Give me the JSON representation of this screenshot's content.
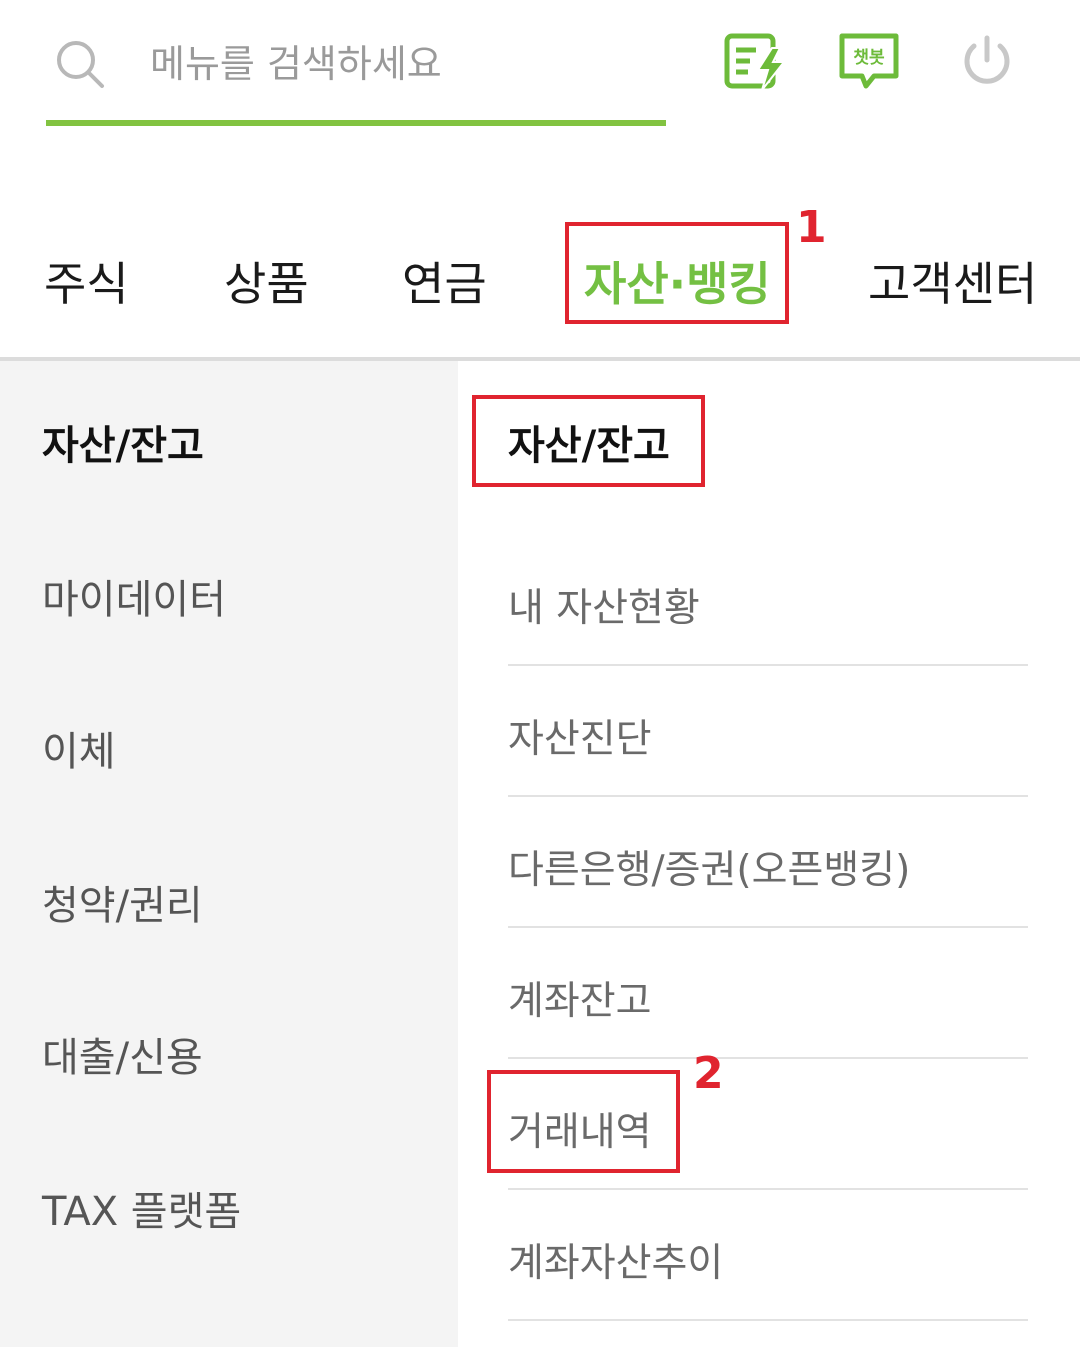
{
  "search": {
    "placeholder": "메뉴를 검색하세요"
  },
  "header_icons": {
    "memo": "memo-lightning-icon",
    "chatbot_label": "챗봇",
    "power": "power-icon"
  },
  "colors": {
    "accent": "#74c043",
    "underline": "#82c341",
    "annotation": "#e0242f"
  },
  "tabs": [
    {
      "label": "주식"
    },
    {
      "label": "상품"
    },
    {
      "label": "연금"
    },
    {
      "label": "자산·뱅킹",
      "active": true
    },
    {
      "label": "고객센터"
    }
  ],
  "left_menu": [
    {
      "label": "자산/잔고",
      "active": true
    },
    {
      "label": "마이데이터"
    },
    {
      "label": "이체"
    },
    {
      "label": "청약/권리"
    },
    {
      "label": "대출/신용"
    },
    {
      "label": "TAX 플랫폼"
    }
  ],
  "right_panel": {
    "title": "자산/잔고",
    "items": [
      {
        "label": "내 자산현황"
      },
      {
        "label": "자산진단"
      },
      {
        "label": "다른은행/증권(오픈뱅킹)"
      },
      {
        "label": "계좌잔고"
      },
      {
        "label": "거래내역"
      },
      {
        "label": "계좌자산추이"
      }
    ]
  },
  "annotations": [
    {
      "number": "1"
    },
    {
      "number": "2"
    }
  ]
}
